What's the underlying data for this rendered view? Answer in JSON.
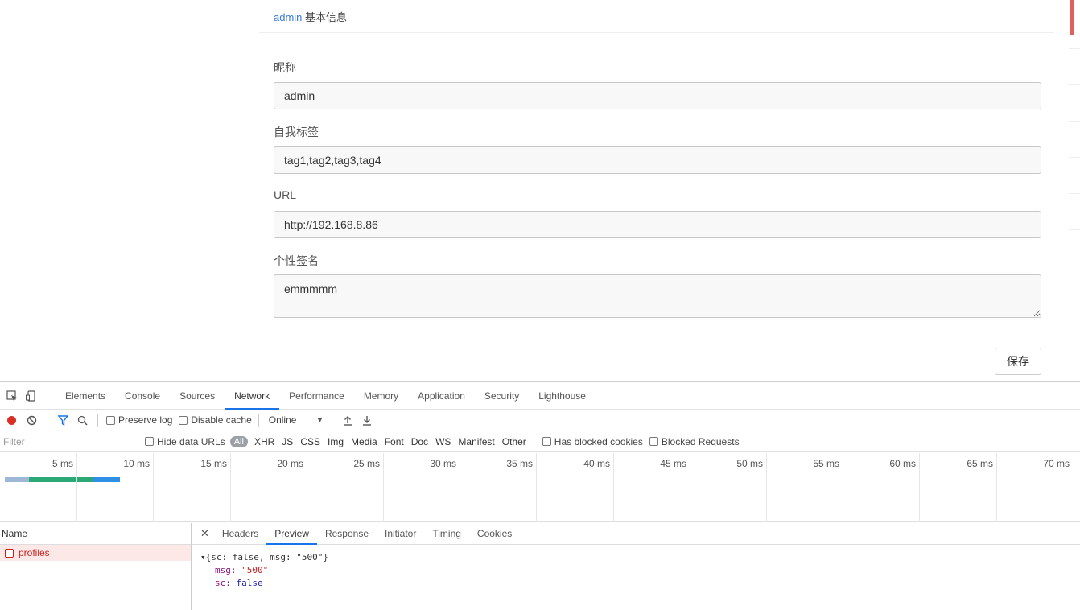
{
  "profile": {
    "header_user": "admin",
    "header_title": "基本信息",
    "nickname_label": "昵称",
    "nickname_value": "admin",
    "tags_label": "自我标签",
    "tags_value": "tag1,tag2,tag3,tag4",
    "url_label": "URL",
    "url_value": "http://192.168.8.86",
    "signature_label": "个性签名",
    "signature_value": "emmmmm",
    "save_label": "保存"
  },
  "devtools": {
    "tabs": [
      "Elements",
      "Console",
      "Sources",
      "Network",
      "Performance",
      "Memory",
      "Application",
      "Security",
      "Lighthouse"
    ],
    "active_tab": "Network",
    "toolbar": {
      "preserve_log": "Preserve log",
      "disable_cache": "Disable cache",
      "throttle": "Online"
    },
    "filter": {
      "placeholder": "Filter",
      "hide_data_urls": "Hide data URLs",
      "all": "All",
      "types": [
        "XHR",
        "JS",
        "CSS",
        "Img",
        "Media",
        "Font",
        "Doc",
        "WS",
        "Manifest",
        "Other"
      ],
      "has_blocked_cookies": "Has blocked cookies",
      "blocked_requests": "Blocked Requests"
    },
    "timeline": {
      "ticks": [
        "5 ms",
        "10 ms",
        "15 ms",
        "20 ms",
        "25 ms",
        "30 ms",
        "35 ms",
        "40 ms",
        "45 ms",
        "50 ms",
        "55 ms",
        "60 ms",
        "65 ms",
        "70 ms"
      ]
    },
    "requests": {
      "header": "Name",
      "items": [
        "profiles"
      ]
    },
    "detail": {
      "tabs": [
        "Headers",
        "Preview",
        "Response",
        "Initiator",
        "Timing",
        "Cookies"
      ],
      "active_tab": "Preview",
      "summary": "▾{sc: false, msg: \"500\"}",
      "msg_key": "msg:",
      "msg_value": "\"500\"",
      "sc_key": "sc:",
      "sc_value": "false"
    },
    "colors": {
      "accent": "#1a73e8",
      "record": "#d93025",
      "error_row": "#fde8e8",
      "error_text": "#c5221f"
    }
  }
}
